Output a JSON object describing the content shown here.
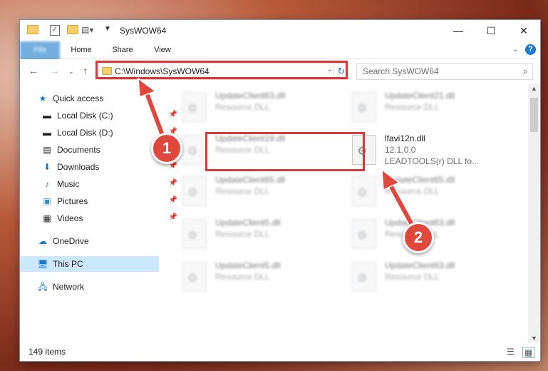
{
  "window": {
    "title": "SysWOW64",
    "controls": {
      "minimize": "—",
      "maximize": "☐",
      "close": "✕"
    }
  },
  "ribbon": {
    "tabs": [
      "File",
      "Home",
      "Share",
      "View"
    ],
    "help": "?"
  },
  "address": {
    "path": "C:\\Windows\\SysWOW64",
    "search_placeholder": "Search SysWOW64"
  },
  "sidebar": {
    "items": [
      {
        "label": "Quick access",
        "icon": "star-icon",
        "pinned": false
      },
      {
        "label": "Local Disk (C:)",
        "icon": "drive-icon",
        "pinned": true
      },
      {
        "label": "Local Disk (D:)",
        "icon": "drive-icon",
        "pinned": true
      },
      {
        "label": "Documents",
        "icon": "document-icon",
        "pinned": true
      },
      {
        "label": "Downloads",
        "icon": "download-icon",
        "pinned": true
      },
      {
        "label": "Music",
        "icon": "music-icon",
        "pinned": true
      },
      {
        "label": "Pictures",
        "icon": "pictures-icon",
        "pinned": true
      },
      {
        "label": "Videos",
        "icon": "video-icon",
        "pinned": true
      },
      {
        "label": "OneDrive",
        "icon": "cloud-icon",
        "pinned": false
      },
      {
        "label": "This PC",
        "icon": "computer-icon",
        "pinned": false,
        "selected": true
      },
      {
        "label": "Network",
        "icon": "network-icon",
        "pinned": false
      }
    ]
  },
  "files": [
    {
      "name": "UpdateClient63.dll",
      "type": "Resource DLL"
    },
    {
      "name": "UpdateClient21.dll",
      "type": "Resource DLL"
    },
    {
      "name": "UpdateClient19.dll",
      "type": "Resource DLL"
    },
    {
      "name": "lfavi12n.dll",
      "version": "12.1.0.0",
      "description": "LEADTOOLS(r) DLL fo..."
    },
    {
      "name": "UpdateClient65.dll",
      "type": "Resource DLL"
    },
    {
      "name": "UpdateClient65.dll",
      "type": "Resource DLL"
    },
    {
      "name": "UpdateClient5.dll",
      "type": "Resource DLL"
    },
    {
      "name": "UpdateClient63.dll",
      "type": "Resource DLL"
    },
    {
      "name": "UpdateClient5.dll",
      "type": "Resource DLL"
    },
    {
      "name": "UpdateClient63.dll",
      "type": "Resource DLL"
    }
  ],
  "status": {
    "item_count": "149 items"
  },
  "annotations": {
    "step1": "1",
    "step2": "2",
    "color": "#e0473d"
  }
}
